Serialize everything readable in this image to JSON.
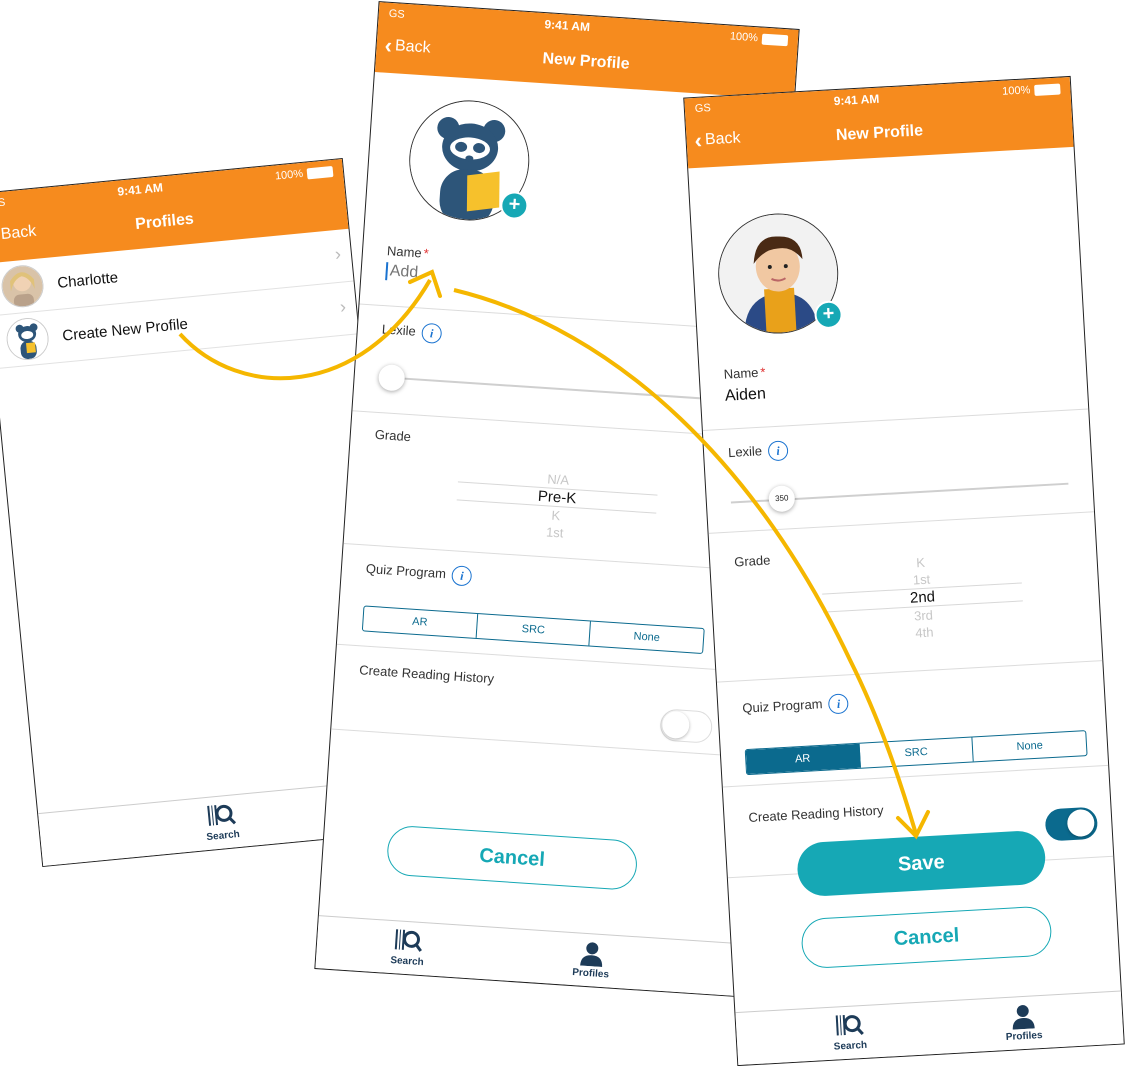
{
  "status": {
    "carrier": "GS",
    "time": "9:41 AM",
    "battery": "100%"
  },
  "screen1": {
    "back_label": "Back",
    "title": "Profiles",
    "profiles": [
      {
        "name": "Charlotte"
      },
      {
        "name": "Create New Profile"
      }
    ],
    "tabs": {
      "search": "Search"
    }
  },
  "screen2": {
    "back_label": "Back",
    "title": "New Profile",
    "name_label": "Name",
    "name_required": "*",
    "name_placeholder": "Add",
    "lexile_label": "Lexile",
    "grade_label": "Grade",
    "grade_picker": [
      "N/A",
      "Pre-K",
      "K",
      "1st"
    ],
    "grade_selected": "Pre-K",
    "quiz_label": "Quiz Program",
    "quiz_options": [
      "AR",
      "SRC",
      "None"
    ],
    "history_label": "Create Reading History",
    "history_on": false,
    "cancel_label": "Cancel",
    "tabs": {
      "search": "Search",
      "profiles": "Profiles"
    }
  },
  "screen3": {
    "back_label": "Back",
    "title": "New Profile",
    "name_label": "Name",
    "name_required": "*",
    "name_value": "Aiden",
    "lexile_label": "Lexile",
    "lexile_value": "350",
    "grade_label": "Grade",
    "grade_picker": [
      "K",
      "1st",
      "2nd",
      "3rd",
      "4th"
    ],
    "grade_selected": "2nd",
    "quiz_label": "Quiz Program",
    "quiz_options": [
      "AR",
      "SRC",
      "None"
    ],
    "quiz_selected": "AR",
    "history_label": "Create Reading History",
    "history_on": true,
    "save_label": "Save",
    "cancel_label": "Cancel",
    "tabs": {
      "search": "Search",
      "profiles": "Profiles"
    }
  },
  "colors": {
    "header": "#f68b1e",
    "teal": "#16a8b5",
    "navy": "#0b6a8e",
    "arrow": "#f5b700"
  }
}
